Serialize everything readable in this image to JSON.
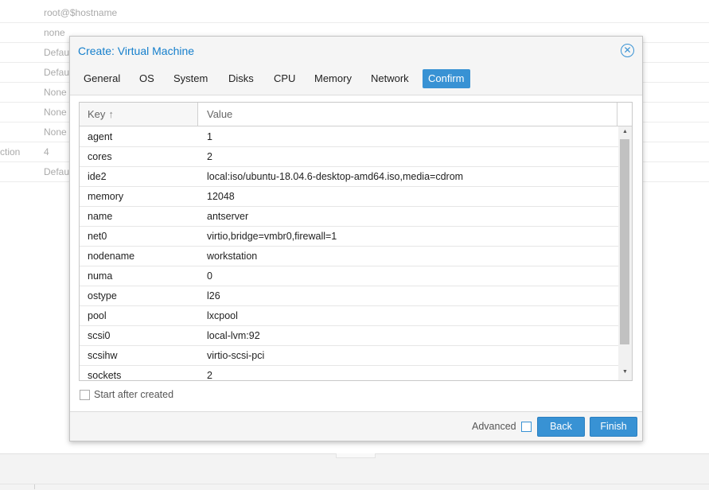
{
  "background": {
    "rows": [
      {
        "key": "",
        "value": "root@$hostname"
      },
      {
        "key": "",
        "value": "none"
      },
      {
        "key": "",
        "value": "Default"
      },
      {
        "key": "",
        "value": "Default"
      },
      {
        "key": "",
        "value": "None"
      },
      {
        "key": "",
        "value": "None"
      },
      {
        "key": "",
        "value": "None"
      },
      {
        "key": "ction",
        "value": "4"
      },
      {
        "key": "",
        "value": "Default"
      }
    ]
  },
  "dialog": {
    "title": "Create: Virtual Machine",
    "close_icon": "close-circle-icon",
    "tabs": [
      {
        "label": "General"
      },
      {
        "label": "OS"
      },
      {
        "label": "System"
      },
      {
        "label": "Disks"
      },
      {
        "label": "CPU"
      },
      {
        "label": "Memory"
      },
      {
        "label": "Network"
      },
      {
        "label": "Confirm",
        "active": true
      }
    ],
    "grid": {
      "columns": {
        "key": "Key",
        "value": "Value"
      },
      "sort_icon": "sort-ascending-icon",
      "rows": [
        {
          "key": "agent",
          "value": "1"
        },
        {
          "key": "cores",
          "value": "2"
        },
        {
          "key": "ide2",
          "value": "local:iso/ubuntu-18.04.6-desktop-amd64.iso,media=cdrom"
        },
        {
          "key": "memory",
          "value": "12048"
        },
        {
          "key": "name",
          "value": "antserver"
        },
        {
          "key": "net0",
          "value": "virtio,bridge=vmbr0,firewall=1"
        },
        {
          "key": "nodename",
          "value": "workstation"
        },
        {
          "key": "numa",
          "value": "0"
        },
        {
          "key": "ostype",
          "value": "l26"
        },
        {
          "key": "pool",
          "value": "lxcpool"
        },
        {
          "key": "scsi0",
          "value": "local-lvm:92"
        },
        {
          "key": "scsihw",
          "value": "virtio-scsi-pci"
        },
        {
          "key": "sockets",
          "value": "2"
        }
      ]
    },
    "start_after_created": {
      "label": "Start after created",
      "checked": false
    },
    "footer": {
      "advanced_label": "Advanced",
      "advanced_checked": false,
      "back_label": "Back",
      "finish_label": "Finish"
    },
    "accent_color": "#3892d4",
    "title_color": "#157fcc"
  }
}
